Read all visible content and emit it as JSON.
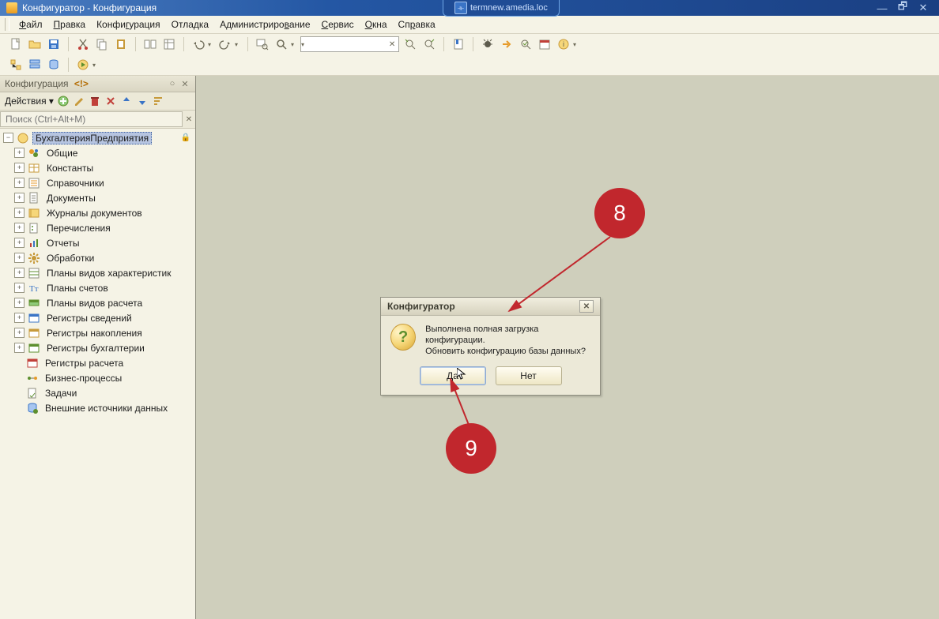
{
  "titlebar": {
    "app_title": "Конфигуратор - Конфигурация",
    "remote_host": "termnew.amedia.loc"
  },
  "menu": {
    "items": [
      "Файл",
      "Правка",
      "Конфигурация",
      "Отладка",
      "Администрирование",
      "Сервис",
      "Окна",
      "Справка"
    ],
    "underline_index_per_item": [
      0,
      0,
      0,
      0,
      0,
      0,
      0,
      0
    ]
  },
  "toolbar": {
    "search_placeholder": ""
  },
  "dock": {
    "title": "Конфигурация",
    "title_modified_marker": "<!>",
    "actions_label": "Действия",
    "search_placeholder": "Поиск (Ctrl+Alt+M)"
  },
  "tree": {
    "root": "БухгалтерияПредприятия",
    "nodes": [
      {
        "icon": "circles-icon",
        "label": "Общие",
        "expandable": true
      },
      {
        "icon": "table-icon",
        "label": "Константы",
        "expandable": true
      },
      {
        "icon": "list-icon",
        "label": "Справочники",
        "expandable": true
      },
      {
        "icon": "doc-icon",
        "label": "Документы",
        "expandable": true
      },
      {
        "icon": "journal-icon",
        "label": "Журналы документов",
        "expandable": true
      },
      {
        "icon": "enum-icon",
        "label": "Перечисления",
        "expandable": true
      },
      {
        "icon": "chart-icon",
        "label": "Отчеты",
        "expandable": true
      },
      {
        "icon": "gear-icon",
        "label": "Обработки",
        "expandable": true
      },
      {
        "icon": "plan-icon",
        "label": "Планы видов характеристик",
        "expandable": true
      },
      {
        "icon": "accounts-icon",
        "label": "Планы счетов",
        "expandable": true
      },
      {
        "icon": "calc-plan-icon",
        "label": "Планы видов расчета",
        "expandable": true
      },
      {
        "icon": "reg-info-icon",
        "label": "Регистры сведений",
        "expandable": true
      },
      {
        "icon": "reg-accum-icon",
        "label": "Регистры накопления",
        "expandable": true
      },
      {
        "icon": "reg-acct-icon",
        "label": "Регистры бухгалтерии",
        "expandable": true
      },
      {
        "icon": "reg-calc-icon",
        "label": "Регистры расчета",
        "expandable": false
      },
      {
        "icon": "bp-icon",
        "label": "Бизнес-процессы",
        "expandable": false
      },
      {
        "icon": "task-icon",
        "label": "Задачи",
        "expandable": false
      },
      {
        "icon": "ext-ds-icon",
        "label": "Внешние источники данных",
        "expandable": false
      }
    ]
  },
  "dialog": {
    "title": "Конфигуратор",
    "line1": "Выполнена полная загрузка конфигурации.",
    "line2": "Обновить конфигурацию базы данных?",
    "yes": "Да",
    "no": "Нет"
  },
  "callouts": {
    "a": "8",
    "b": "9"
  }
}
